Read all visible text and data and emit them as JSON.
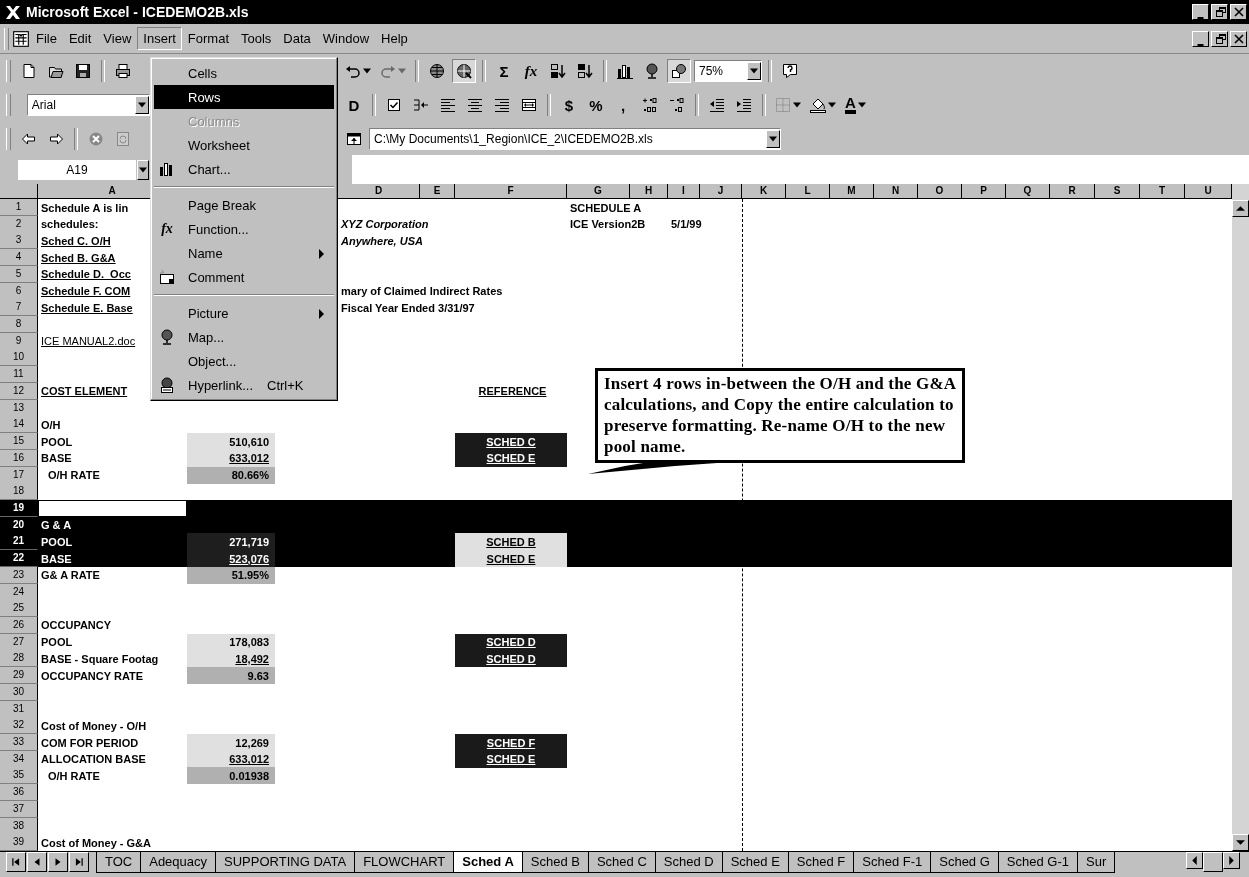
{
  "window": {
    "title": "Microsoft Excel - ICEDEMO2B.xls"
  },
  "menu_bar": [
    {
      "label": "File",
      "selected": false
    },
    {
      "label": "Edit",
      "selected": false
    },
    {
      "label": "View",
      "selected": false
    },
    {
      "label": "Insert",
      "selected": true
    },
    {
      "label": "Format",
      "selected": false
    },
    {
      "label": "Tools",
      "selected": false
    },
    {
      "label": "Data",
      "selected": false
    },
    {
      "label": "Window",
      "selected": false
    },
    {
      "label": "Help",
      "selected": false
    }
  ],
  "toolbars": [
    {
      "left_items": [
        {
          "kind": "button",
          "pressed": false
        },
        {
          "kind": "button",
          "pressed": false
        },
        {
          "kind": "button",
          "pressed": false
        },
        {
          "kind": "separator"
        },
        {
          "kind": "button",
          "pressed": false
        }
      ],
      "right_items": [
        {
          "kind": "split",
          "disabled": false
        },
        {
          "kind": "split",
          "disabled": true
        },
        {
          "kind": "separator"
        },
        {
          "kind": "button",
          "pressed": false
        },
        {
          "kind": "button",
          "pressed": true
        },
        {
          "kind": "separator"
        },
        {
          "kind": "glyph",
          "label": "Σ",
          "pressed": false
        },
        {
          "kind": "glyph",
          "label": "fx",
          "pressed": false
        },
        {
          "kind": "button",
          "pressed": false
        },
        {
          "kind": "button",
          "pressed": false
        },
        {
          "kind": "separator"
        },
        {
          "kind": "button",
          "pressed": false
        },
        {
          "kind": "button",
          "pressed": false
        },
        {
          "kind": "button",
          "pressed": true
        },
        {
          "kind": "combo",
          "value": "75%"
        },
        {
          "kind": "separator"
        },
        {
          "kind": "button",
          "pressed": false
        }
      ]
    },
    {
      "left_items": [
        {
          "kind": "combo",
          "value": "Arial"
        }
      ],
      "right_items": [
        {
          "kind": "glyph",
          "label": "D"
        },
        {
          "kind": "separator"
        },
        {
          "kind": "button"
        },
        {
          "kind": "button"
        },
        {
          "kind": "button"
        },
        {
          "kind": "button"
        },
        {
          "kind": "button"
        },
        {
          "kind": "button"
        },
        {
          "kind": "separator"
        },
        {
          "kind": "glyph",
          "label": "$"
        },
        {
          "kind": "glyph",
          "label": "%"
        },
        {
          "kind": "glyph",
          "label": ","
        },
        {
          "kind": "button"
        },
        {
          "kind": "button"
        },
        {
          "kind": "separator"
        },
        {
          "kind": "button"
        },
        {
          "kind": "button"
        },
        {
          "kind": "separator"
        },
        {
          "kind": "split",
          "disabled": false
        },
        {
          "kind": "split",
          "disabled": false
        },
        {
          "kind": "split",
          "disabled": false,
          "label": "A"
        }
      ]
    },
    {
      "left_items": [
        {
          "kind": "button"
        },
        {
          "kind": "button"
        },
        {
          "kind": "separator"
        },
        {
          "kind": "button"
        },
        {
          "kind": "button"
        }
      ],
      "right_items": [
        {
          "kind": "button"
        },
        {
          "kind": "combo",
          "value": "C:\\My Documents\\1_Region\\ICE_2\\ICEDEMO2B.xls"
        }
      ]
    }
  ],
  "name_box": {
    "value": "A19"
  },
  "insert_menu": [
    {
      "kind": "item",
      "label": "Cells",
      "selected": false,
      "disabled": false
    },
    {
      "kind": "item",
      "label": "Rows",
      "selected": true,
      "disabled": false
    },
    {
      "kind": "item",
      "label": "Columns",
      "selected": false,
      "disabled": true
    },
    {
      "kind": "item",
      "label": "Worksheet",
      "selected": false,
      "disabled": false
    },
    {
      "kind": "item",
      "label": "Chart...",
      "selected": false,
      "disabled": false
    },
    {
      "kind": "separator"
    },
    {
      "kind": "item",
      "label": "Page Break",
      "selected": false,
      "disabled": false
    },
    {
      "kind": "item",
      "label": "Function...",
      "selected": false,
      "disabled": false,
      "glyph": "fx"
    },
    {
      "kind": "item",
      "label": "Name",
      "selected": false,
      "disabled": false,
      "submenu": true
    },
    {
      "kind": "item",
      "label": "Comment",
      "selected": false,
      "disabled": false
    },
    {
      "kind": "separator"
    },
    {
      "kind": "item",
      "label": "Picture",
      "selected": false,
      "disabled": false,
      "submenu": true
    },
    {
      "kind": "item",
      "label": "Map...",
      "selected": false,
      "disabled": false
    },
    {
      "kind": "item",
      "label": "Object...",
      "selected": false,
      "disabled": false
    },
    {
      "kind": "item",
      "label": "Hyperlink...",
      "selected": false,
      "disabled": false,
      "shortcut": "Ctrl+K"
    }
  ],
  "columns": [
    "A",
    "D",
    "E",
    "F",
    "G",
    "H",
    "I",
    "J",
    "K",
    "L",
    "M",
    "N",
    "O",
    "P",
    "Q",
    "R",
    "S",
    "T",
    "U"
  ],
  "rows": [
    {
      "n": "1",
      "selected": false,
      "cells": {
        "A": {
          "kind": "label",
          "text": "Schedule A is lin"
        },
        "G": {
          "kind": "label",
          "text": "SCHEDULE A"
        }
      }
    },
    {
      "n": "2",
      "selected": false,
      "cells": {
        "A": {
          "kind": "label",
          "text": "schedules:"
        },
        "D": {
          "kind": "title",
          "text": "XYZ Corporation"
        },
        "G": {
          "kind": "label",
          "text": "ICE Version2B"
        },
        "I": {
          "kind": "label",
          "text": "5/1/99"
        }
      }
    },
    {
      "n": "3",
      "selected": false,
      "cells": {
        "A": {
          "kind": "heading",
          "text": "Sched C. O/H"
        },
        "D": {
          "kind": "title",
          "text": "Anywhere, USA"
        }
      }
    },
    {
      "n": "4",
      "selected": false,
      "cells": {
        "A": {
          "kind": "heading",
          "text": "Sched B. G&A"
        }
      }
    },
    {
      "n": "5",
      "selected": false,
      "cells": {
        "A": {
          "kind": "heading",
          "text": "Schedule D.  Occ"
        }
      }
    },
    {
      "n": "6",
      "selected": false,
      "cells": {
        "A": {
          "kind": "heading",
          "text": "Schedule F. COM"
        },
        "D": {
          "kind": "label",
          "text": "mary of Claimed Indirect Rates"
        }
      }
    },
    {
      "n": "7",
      "selected": false,
      "cells": {
        "A": {
          "kind": "heading",
          "text": "Schedule E. Base"
        },
        "D": {
          "kind": "label",
          "text": "Fiscal Year Ended 3/31/97"
        }
      }
    },
    {
      "n": "8",
      "selected": false,
      "cells": {}
    },
    {
      "n": "9",
      "selected": false,
      "cells": {
        "A": {
          "kind": "link",
          "text": "ICE MANUAL2.doc"
        }
      }
    },
    {
      "n": "10",
      "selected": false,
      "cells": {}
    },
    {
      "n": "11",
      "selected": false,
      "cells": {}
    },
    {
      "n": "12",
      "selected": false,
      "cells": {
        "A": {
          "kind": "heading",
          "text": "COST ELEMENT"
        },
        "F": {
          "kind": "heading",
          "text": "REFERENCE"
        }
      }
    },
    {
      "n": "13",
      "selected": false,
      "cells": {}
    },
    {
      "n": "14",
      "selected": false,
      "cells": {
        "A": {
          "kind": "label",
          "text": "O/H"
        }
      }
    },
    {
      "n": "15",
      "selected": false,
      "cells": {
        "A": {
          "kind": "label",
          "text": "POOL"
        },
        "B": {
          "kind": "value",
          "text": "510,610",
          "underlined": false
        },
        "F": {
          "kind": "ref",
          "text": "SCHED C"
        }
      }
    },
    {
      "n": "16",
      "selected": false,
      "cells": {
        "A": {
          "kind": "label",
          "text": "BASE"
        },
        "B": {
          "kind": "value",
          "text": "633,012",
          "underlined": true
        },
        "F": {
          "kind": "ref",
          "text": "SCHED E"
        }
      }
    },
    {
      "n": "17",
      "selected": false,
      "cells": {
        "A": {
          "kind": "indented",
          "text": "O/H RATE"
        },
        "B": {
          "kind": "rate",
          "text": "80.66%"
        }
      }
    },
    {
      "n": "18",
      "selected": false,
      "cells": {}
    },
    {
      "n": "19",
      "selected": true,
      "active_cell": true,
      "cells": {}
    },
    {
      "n": "20",
      "selected": true,
      "cells": {
        "A": {
          "kind": "label",
          "text": "G & A"
        }
      }
    },
    {
      "n": "21",
      "selected": true,
      "cells": {
        "A": {
          "kind": "label",
          "text": "POOL"
        },
        "B": {
          "kind": "value",
          "text": "271,719",
          "underlined": false
        },
        "F": {
          "kind": "ref",
          "text": "SCHED B"
        }
      }
    },
    {
      "n": "22",
      "selected": true,
      "cells": {
        "A": {
          "kind": "label",
          "text": "BASE"
        },
        "B": {
          "kind": "value",
          "text": "523,076",
          "underlined": true
        },
        "F": {
          "kind": "ref",
          "text": "SCHED E"
        }
      }
    },
    {
      "n": "23",
      "selected": false,
      "cells": {
        "A": {
          "kind": "label",
          "text": "G& A RATE"
        },
        "B": {
          "kind": "rate",
          "text": "51.95%"
        }
      }
    },
    {
      "n": "24",
      "selected": false,
      "cells": {}
    },
    {
      "n": "25",
      "selected": false,
      "cells": {}
    },
    {
      "n": "26",
      "selected": false,
      "cells": {
        "A": {
          "kind": "label",
          "text": "OCCUPANCY"
        }
      }
    },
    {
      "n": "27",
      "selected": false,
      "cells": {
        "A": {
          "kind": "label",
          "text": "POOL"
        },
        "B": {
          "kind": "value",
          "text": "178,083",
          "underlined": false
        },
        "F": {
          "kind": "ref",
          "text": "SCHED D"
        }
      }
    },
    {
      "n": "28",
      "selected": false,
      "cells": {
        "A": {
          "kind": "label",
          "text": "BASE - Square Footag"
        },
        "B": {
          "kind": "value",
          "text": "18,492",
          "underlined": true
        },
        "F": {
          "kind": "ref",
          "text": "SCHED D"
        }
      }
    },
    {
      "n": "29",
      "selected": false,
      "cells": {
        "A": {
          "kind": "label",
          "text": "OCCUPANCY RATE"
        },
        "B": {
          "kind": "rate",
          "text": "9.63"
        }
      }
    },
    {
      "n": "30",
      "selected": false,
      "cells": {}
    },
    {
      "n": "31",
      "selected": false,
      "cells": {}
    },
    {
      "n": "32",
      "selected": false,
      "cells": {
        "A": {
          "kind": "label",
          "text": "Cost of Money - O/H"
        }
      }
    },
    {
      "n": "33",
      "selected": false,
      "cells": {
        "A": {
          "kind": "label",
          "text": "COM FOR PERIOD"
        },
        "B": {
          "kind": "value",
          "text": "12,269",
          "underlined": false
        },
        "F": {
          "kind": "ref",
          "text": "SCHED F"
        }
      }
    },
    {
      "n": "34",
      "selected": false,
      "cells": {
        "A": {
          "kind": "label",
          "text": "ALLOCATION BASE"
        },
        "B": {
          "kind": "value",
          "text": "633,012",
          "underlined": true
        },
        "F": {
          "kind": "ref",
          "text": "SCHED E"
        }
      }
    },
    {
      "n": "35",
      "selected": false,
      "cells": {
        "A": {
          "kind": "indented",
          "text": "O/H RATE"
        },
        "B": {
          "kind": "rate",
          "text": "0.01938"
        }
      }
    },
    {
      "n": "36",
      "selected": false,
      "cells": {}
    },
    {
      "n": "37",
      "selected": false,
      "cells": {}
    },
    {
      "n": "38",
      "selected": false,
      "cells": {}
    },
    {
      "n": "39",
      "selected": false,
      "cells": {
        "A": {
          "kind": "label",
          "text": "Cost of Money - G&A"
        }
      }
    }
  ],
  "callout": {
    "text": "Insert 4 rows in-between the O/H and the G&A calculations, and Copy the entire calculation to preserve formatting.  Re-name O/H to the new pool name."
  },
  "sheet_tabs": [
    {
      "label": "TOC",
      "selected": false
    },
    {
      "label": "Adequacy",
      "selected": false
    },
    {
      "label": "SUPPORTING DATA",
      "selected": false
    },
    {
      "label": "FLOWCHART",
      "selected": false
    },
    {
      "label": "Sched A",
      "selected": true
    },
    {
      "label": "Sched B",
      "selected": false
    },
    {
      "label": "Sched C",
      "selected": false
    },
    {
      "label": "Sched D",
      "selected": false
    },
    {
      "label": "Sched E",
      "selected": false
    },
    {
      "label": "Sched F",
      "selected": false
    },
    {
      "label": "Sched F-1",
      "selected": false
    },
    {
      "label": "Sched G",
      "selected": false
    },
    {
      "label": "Sched G-1",
      "selected": false
    },
    {
      "label": "Sur",
      "selected": false
    }
  ]
}
